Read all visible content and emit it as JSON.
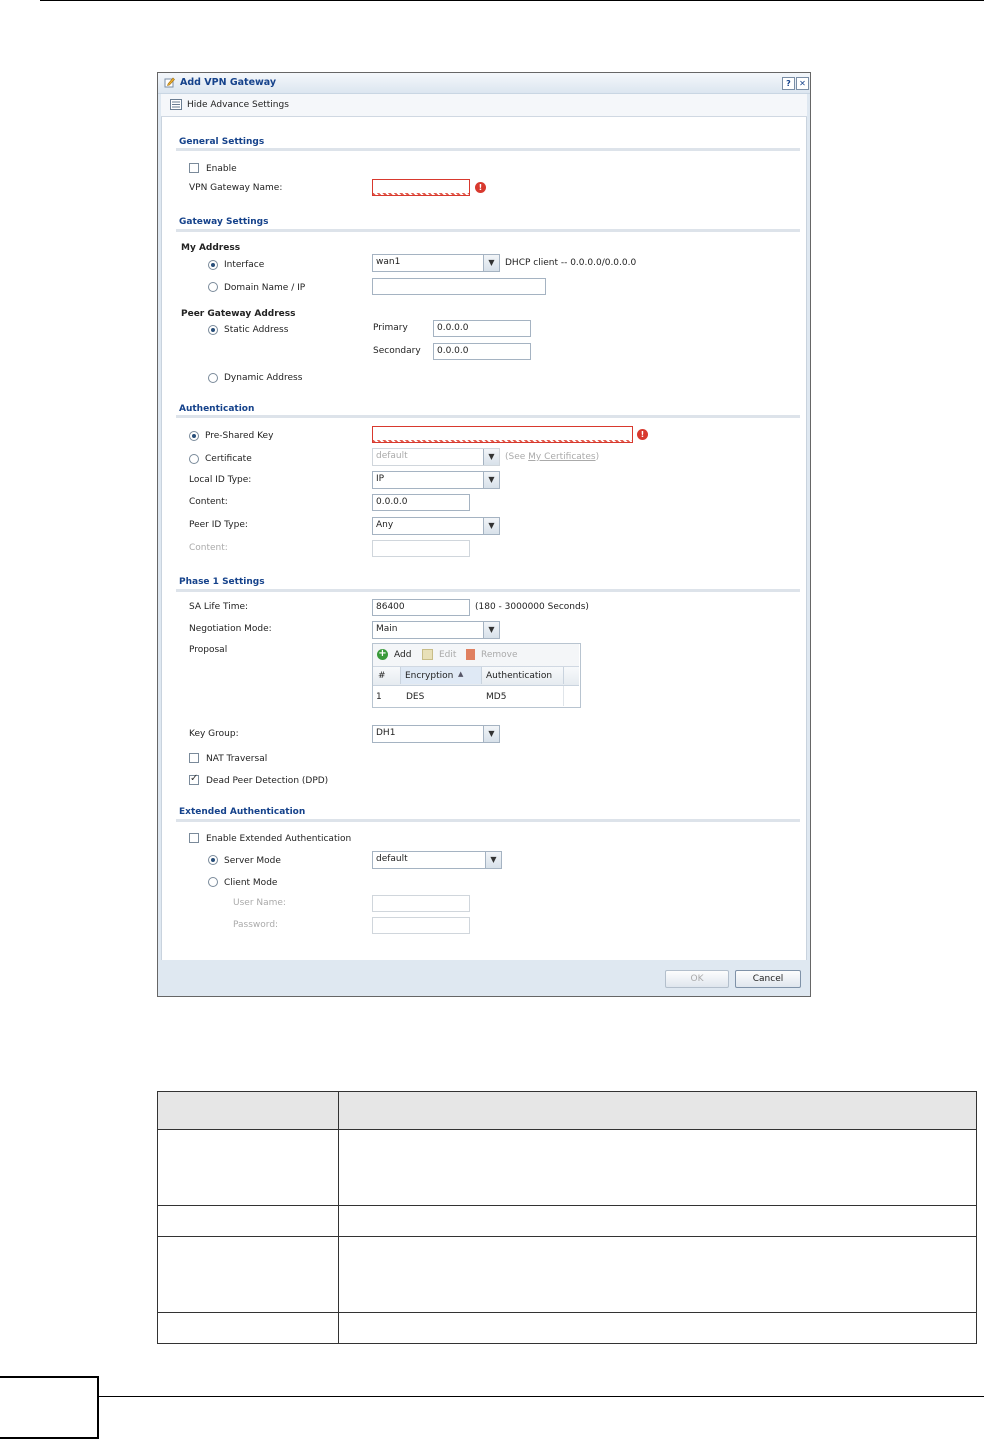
{
  "dialog": {
    "title": "Add VPN Gateway",
    "help_label": "?",
    "close_label": "✕",
    "toolbar_label": "Hide Advance Settings"
  },
  "general": {
    "heading": "General Settings",
    "enable_label": "Enable",
    "enable_checked": false,
    "name_label": "VPN Gateway Name:",
    "name_value": ""
  },
  "gateway": {
    "heading": "Gateway Settings",
    "my_address_label": "My Address",
    "interface_label": "Interface",
    "interface_value": "wan1",
    "interface_info": "DHCP client -- 0.0.0.0/0.0.0.0",
    "domain_label": "Domain Name / IP",
    "domain_value": "",
    "peer_label": "Peer Gateway Address",
    "static_label": "Static Address",
    "primary_label": "Primary",
    "primary_value": "0.0.0.0",
    "secondary_label": "Secondary",
    "secondary_value": "0.0.0.0",
    "dynamic_label": "Dynamic Address"
  },
  "auth": {
    "heading": "Authentication",
    "psk_label": "Pre-Shared Key",
    "psk_value": "",
    "cert_label": "Certificate",
    "cert_value": "default",
    "see_prefix": "(See ",
    "see_link": "My Certificates",
    "see_suffix": ")",
    "local_id_label": "Local ID Type:",
    "local_id_value": "IP",
    "content_label": "Content:",
    "content_value": "0.0.0.0",
    "peer_id_label": "Peer ID Type:",
    "peer_id_value": "Any",
    "peer_content_label": "Content:",
    "peer_content_value": ""
  },
  "phase1": {
    "heading": "Phase 1 Settings",
    "sa_label": "SA Life Time:",
    "sa_value": "86400",
    "sa_hint": "(180 - 3000000 Seconds)",
    "neg_label": "Negotiation Mode:",
    "neg_value": "Main",
    "proposal_label": "Proposal",
    "add_label": "Add",
    "edit_label": "Edit",
    "remove_label": "Remove",
    "col_num": "#",
    "col_enc": "Encryption",
    "col_auth": "Authentication",
    "rows": [
      {
        "num": "1",
        "enc": "DES",
        "auth": "MD5"
      }
    ],
    "keygroup_label": "Key Group:",
    "keygroup_value": "DH1",
    "nat_label": "NAT Traversal",
    "nat_checked": false,
    "dpd_label": "Dead Peer Detection (DPD)",
    "dpd_checked": true
  },
  "xauth": {
    "heading": "Extended Authentication",
    "enable_label": "Enable Extended Authentication",
    "server_label": "Server Mode",
    "server_value": "default",
    "client_label": "Client Mode",
    "user_label": "User Name:",
    "user_value": "",
    "pass_label": "Password:",
    "pass_value": ""
  },
  "footer": {
    "ok_label": "OK",
    "cancel_label": "Cancel"
  },
  "colors": {
    "title_blue": "#15428b",
    "error_red": "#d8392e",
    "dialog_bg": "#dfe8f1"
  }
}
